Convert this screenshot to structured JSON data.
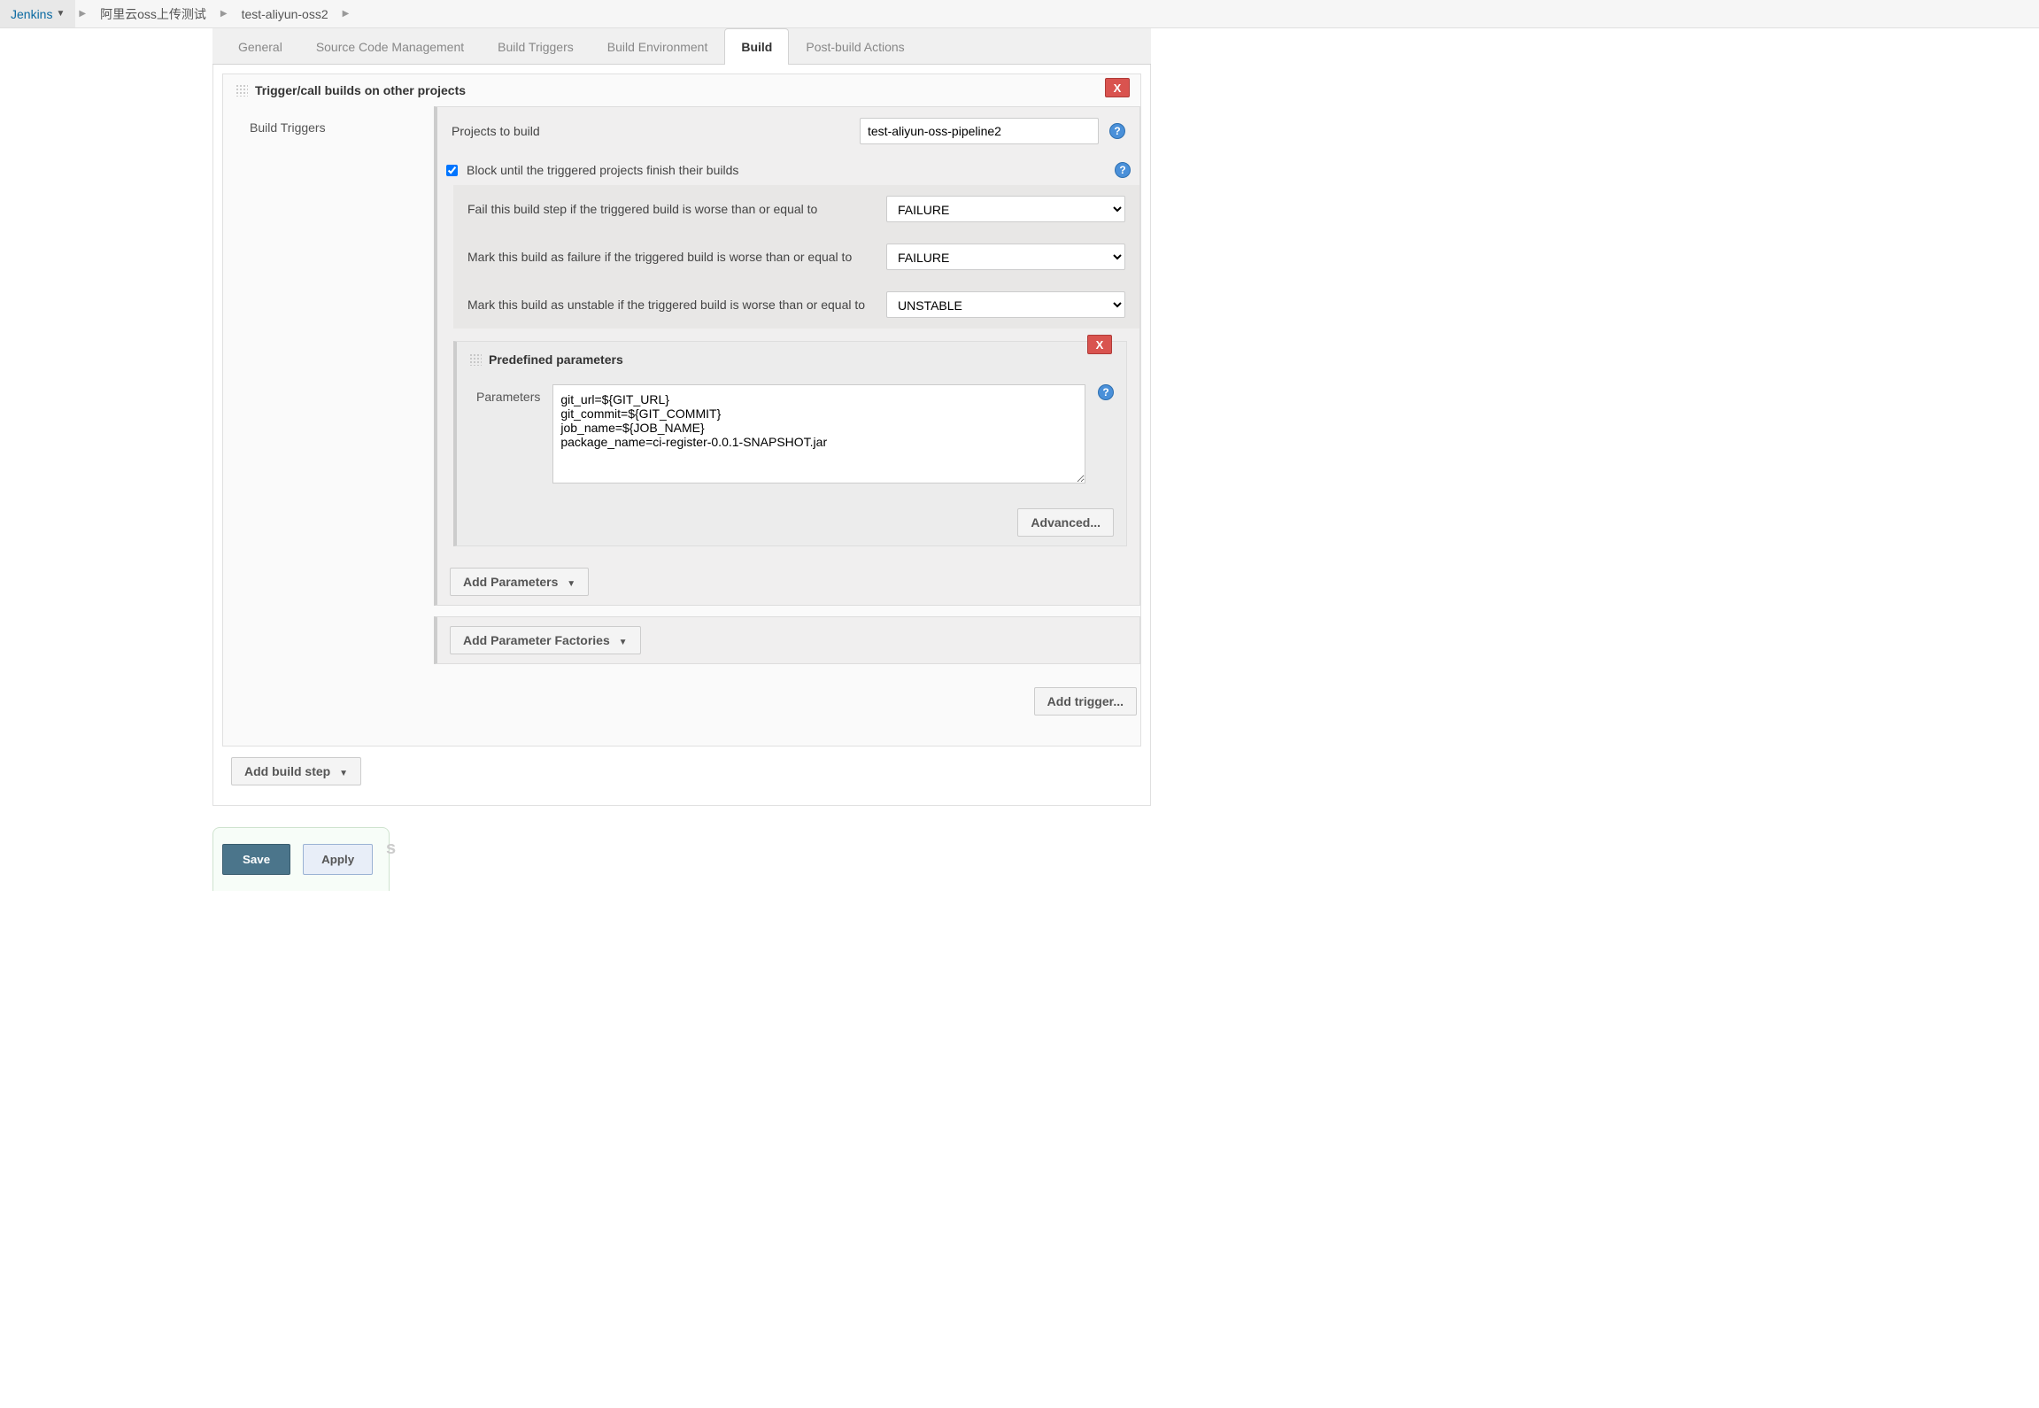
{
  "breadcrumb": {
    "jenkins": "Jenkins",
    "item1": "阿里云oss上传测试",
    "item2": "test-aliyun-oss2"
  },
  "tabs": {
    "general": "General",
    "scm": "Source Code Management",
    "triggers": "Build Triggers",
    "env": "Build Environment",
    "build": "Build",
    "post": "Post-build Actions"
  },
  "section": {
    "title": "Trigger/call builds on other projects",
    "delete": "X",
    "side_label": "Build Triggers",
    "projects_label": "Projects to build",
    "projects_value": "test-aliyun-oss-pipeline2",
    "block_label": "Block until the triggered projects finish their builds",
    "fail_label": "Fail this build step if the triggered build is worse than or equal to",
    "fail_value": "FAILURE",
    "mark_fail_label": "Mark this build as failure if the triggered build is worse than or equal to",
    "mark_fail_value": "FAILURE",
    "mark_unstable_label": "Mark this build as unstable if the triggered build is worse than or equal to",
    "mark_unstable_value": "UNSTABLE",
    "params": {
      "title": "Predefined parameters",
      "label": "Parameters",
      "value": "git_url=${GIT_URL}\ngit_commit=${GIT_COMMIT}\njob_name=${JOB_NAME}\npackage_name=ci-register-0.0.1-SNAPSHOT.jar",
      "delete": "X"
    },
    "advanced": "Advanced...",
    "add_params": "Add Parameters",
    "add_factories": "Add Parameter Factories",
    "add_trigger": "Add trigger..."
  },
  "add_build_step": "Add build step",
  "footer": {
    "save": "Save",
    "apply": "Apply",
    "ghost": "s"
  },
  "help": "?"
}
